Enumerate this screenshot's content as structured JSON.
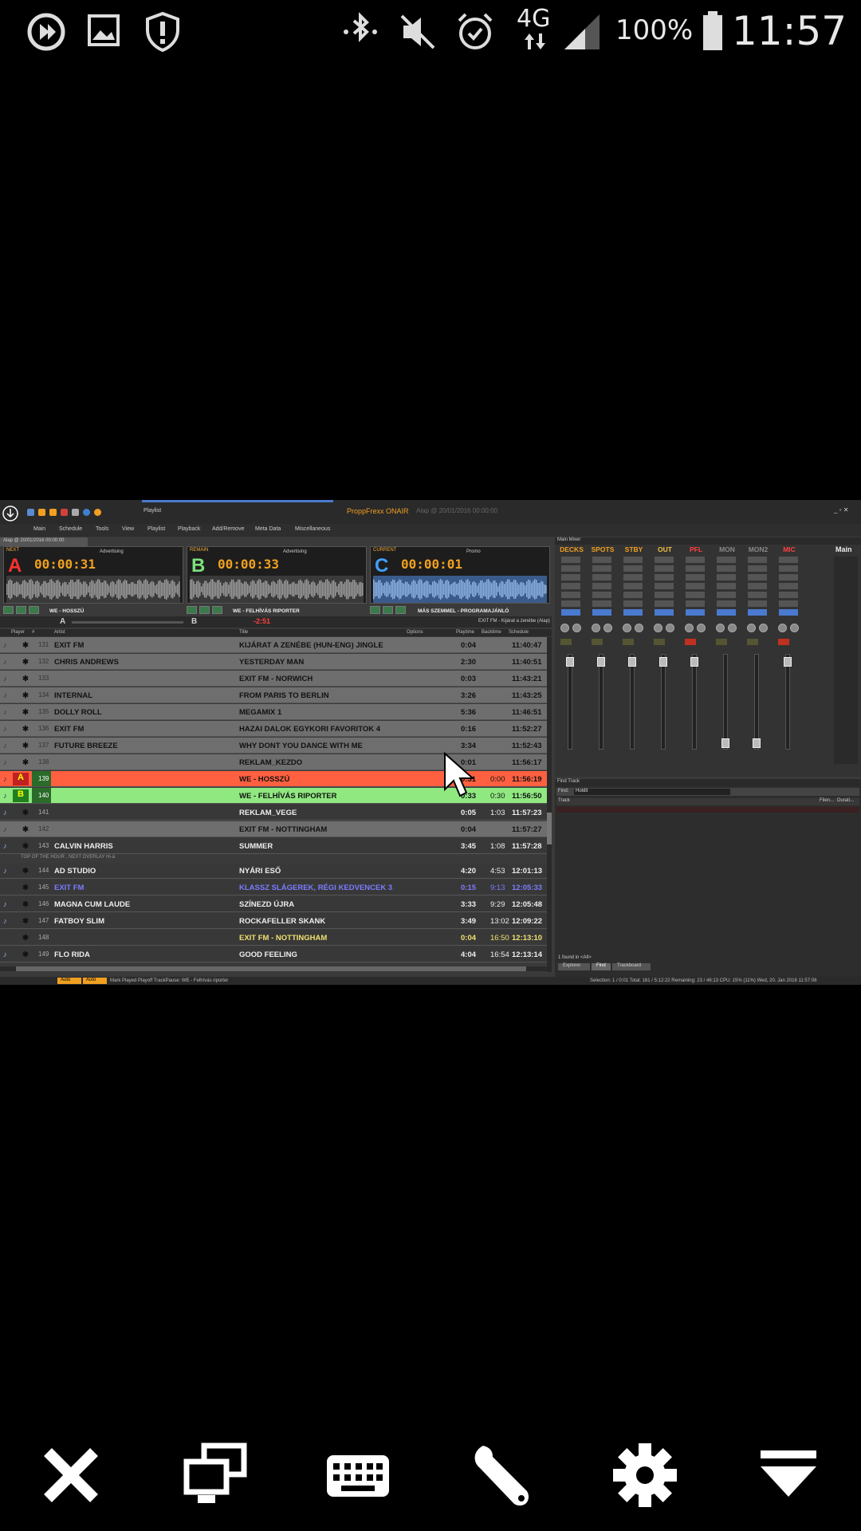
{
  "status_bar": {
    "battery": "100%",
    "network": "4G",
    "time": "11:57"
  },
  "app": {
    "title": "ProppFrexx ONAIR",
    "subtitle": "Alap @ 20/01/2016 00:00:00",
    "playlist_tab": "Playlist",
    "menu_tabs": [
      "Main",
      "Schedule",
      "Tools",
      "View",
      "Playlist",
      "Playback",
      "Add/Remove",
      "Meta Data",
      "Miscellaneous"
    ],
    "doc_tab": "Alap @ 20/01/2016 00:00:00",
    "players": [
      {
        "letter": "A",
        "label": "NEXT",
        "time": "00:00:31",
        "ad": "Advertising",
        "color": "#ff3030",
        "name": "WE - HOSSZÚ"
      },
      {
        "letter": "B",
        "label": "REMAIN",
        "time": "00:00:33",
        "ad": "Advertising",
        "color": "#7ce07c",
        "name": "WE - FELHÍVÁS RIPORTER"
      },
      {
        "letter": "C",
        "label": "CURRENT",
        "time": "00:00:01",
        "ad": "Promo",
        "color": "#40a0ff",
        "name": "MÁS SZEMMEL - PROGRAMAJÁNLÓ"
      }
    ],
    "crossfade": {
      "a": "A",
      "b": "B",
      "remain": "-2:51",
      "info": "EXIT FM - Kijárat a zenébe (Alap)"
    },
    "grid_headers": [
      "Player",
      "#",
      "Artist",
      "Title",
      "Options",
      "Playtime",
      "Backtime",
      "Schedule"
    ],
    "rows": [
      {
        "num": "131",
        "artist": "EXIT FM",
        "title": "KIJÁRAT A ZENÉBE (HUN-ENG) JINGLE",
        "play": "0:04",
        "back": "",
        "sched": "11:40:47",
        "style": "gray"
      },
      {
        "num": "132",
        "artist": "CHRIS ANDREWS",
        "title": "YESTERDAY MAN",
        "play": "2:30",
        "back": "",
        "sched": "11:40:51",
        "style": "gray"
      },
      {
        "num": "133",
        "artist": "",
        "title": "EXIT FM - NORWICH",
        "play": "0:03",
        "back": "",
        "sched": "11:43:21",
        "style": "gray"
      },
      {
        "num": "134",
        "artist": "INTERNAL",
        "title": "FROM PARIS TO BERLIN",
        "play": "3:26",
        "back": "",
        "sched": "11:43:25",
        "style": "gray"
      },
      {
        "num": "135",
        "artist": "DOLLY ROLL",
        "title": "MEGAMIX 1",
        "play": "5:36",
        "back": "",
        "sched": "11:46:51",
        "style": "gray"
      },
      {
        "num": "136",
        "artist": "EXIT FM",
        "title": "HAZAI DALOK EGYKORI FAVORITOK 4",
        "play": "0:16",
        "back": "",
        "sched": "11:52:27",
        "style": "gray"
      },
      {
        "num": "137",
        "artist": "FUTURE BREEZE",
        "title": "WHY DONT YOU DANCE WITH ME",
        "play": "3:34",
        "back": "",
        "sched": "11:52:43",
        "style": "gray"
      },
      {
        "num": "138",
        "artist": "",
        "title": "REKLAM_KEZDO",
        "play": "0:01",
        "back": "",
        "sched": "11:56:17",
        "style": "gray"
      },
      {
        "num": "139",
        "artist": "",
        "title": "WE - HOSSZÚ",
        "play": "0:31",
        "back": "0:00",
        "sched": "11:56:19",
        "style": "red",
        "marker": "A"
      },
      {
        "num": "140",
        "artist": "",
        "title": "WE - FELHÍVÁS RIPORTER",
        "play": "0:33",
        "back": "0:30",
        "sched": "11:56:50",
        "style": "green",
        "marker": "B"
      },
      {
        "num": "141",
        "artist": "",
        "title": "REKLAM_VEGE",
        "play": "0:05",
        "back": "1:03",
        "sched": "11:57:23",
        "style": "dark"
      },
      {
        "num": "142",
        "artist": "",
        "title": "EXIT FM - NOTTINGHAM",
        "play": "0:04",
        "back": "",
        "sched": "11:57:27",
        "style": "gray"
      },
      {
        "num": "143",
        "artist": "CALVIN HARRIS",
        "title": "SUMMER",
        "play": "3:45",
        "back": "1:08",
        "sched": "11:57:28",
        "style": "dark"
      },
      {
        "num": "144",
        "artist": "AD STUDIO",
        "title": "NYÁRI ESŐ",
        "play": "4:20",
        "back": "4:53",
        "sched": "12:01:13",
        "style": "dark"
      },
      {
        "num": "145",
        "artist": "EXIT FM",
        "title": "KLASSZ SLÁGEREK, RÉGI KEDVENCEK 3",
        "play": "0:15",
        "back": "9:13",
        "sched": "12:05:33",
        "style": "blue"
      },
      {
        "num": "146",
        "artist": "MAGNA CUM LAUDE",
        "title": "SZÍNEZD ÚJRA",
        "play": "3:33",
        "back": "9:29",
        "sched": "12:05:48",
        "style": "dark"
      },
      {
        "num": "147",
        "artist": "FATBOY SLIM",
        "title": "ROCKAFELLER SKANK",
        "play": "3:49",
        "back": "13:02",
        "sched": "12:09:22",
        "style": "dark"
      },
      {
        "num": "148",
        "artist": "",
        "title": "EXIT FM - NOTTINGHAM",
        "play": "0:04",
        "back": "16:50",
        "sched": "12:13:10",
        "style": "yellow"
      },
      {
        "num": "149",
        "artist": "FLO RIDA",
        "title": "GOOD FEELING",
        "play": "4:04",
        "back": "16:54",
        "sched": "12:13:14",
        "style": "dark"
      }
    ],
    "overlay_note": "TOP OF THE HOUR , NEXT OVERLAY Hi-ä",
    "mixer": {
      "title": "Main Mixer",
      "main": "Main",
      "channels": [
        {
          "name": "DECKS",
          "color": "#f0a020"
        },
        {
          "name": "SPOTS",
          "color": "#f0a020"
        },
        {
          "name": "STBY",
          "color": "#f0a020"
        },
        {
          "name": "OUT",
          "color": "#f0c040"
        },
        {
          "name": "PFL",
          "color": "#ff4040"
        },
        {
          "name": "MON",
          "color": "#888888"
        },
        {
          "name": "MON2",
          "color": "#888888"
        },
        {
          "name": "MIC",
          "color": "#ff4040"
        }
      ]
    },
    "find": {
      "title": "Find Track",
      "label": "Find:",
      "value": "Holdit",
      "col": "Track",
      "col2": "Filen...",
      "col3": "Durati...",
      "result": "1 found in <All>",
      "tabs": [
        "Explorer",
        "Find",
        "Trackboard"
      ]
    },
    "bottom": {
      "auto1": "Auto",
      "auto2": "Auto",
      "status": "Mark Played   Playoff TrackPause: WE - Felhívás riporter",
      "info": "Selection: 1 / 0:01    Total: 161 / 5:12:22    Remaining: 23 / 46:13    CPU: 15% (11%)    Wed, 20. Jan 2016 11:57:08"
    }
  }
}
